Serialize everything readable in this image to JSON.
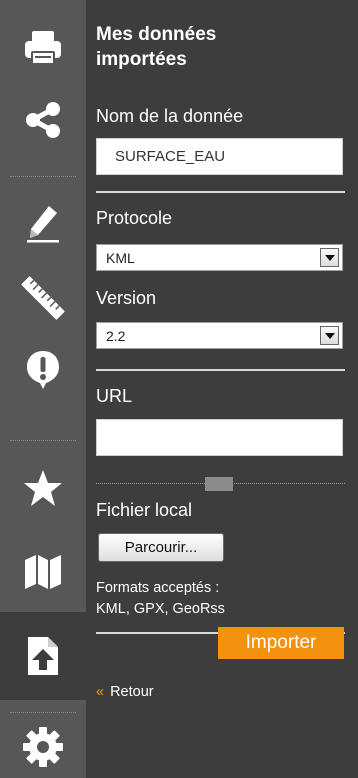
{
  "toolbar": {
    "tools": [
      {
        "name": "print-icon"
      },
      {
        "name": "share-icon"
      },
      {
        "name": "pencil-icon"
      },
      {
        "name": "ruler-icon"
      },
      {
        "name": "alert-icon"
      },
      {
        "name": "star-icon"
      },
      {
        "name": "map-icon"
      },
      {
        "name": "import-file-icon",
        "active": true
      },
      {
        "name": "gear-icon"
      }
    ]
  },
  "panel": {
    "title_line1": "Mes données",
    "title_line2": "importées",
    "name_label": "Nom de la donnée",
    "name_value": "SURFACE_EAU",
    "protocol_label": "Protocole",
    "protocol_value": "KML",
    "version_label": "Version",
    "version_value": "2.2",
    "url_label": "URL",
    "url_value": "",
    "local_file_label": "Fichier local",
    "browse_label": "Parcourir...",
    "formats_line1": "Formats acceptés :",
    "formats_line2": "KML, GPX, GeoRss",
    "import_label": "Importer",
    "back_chevron": "«",
    "back_label": "Retour"
  },
  "colors": {
    "panel_bg": "#3d3d3d",
    "toolbar_bg": "#575757",
    "accent": "#f3920f"
  }
}
